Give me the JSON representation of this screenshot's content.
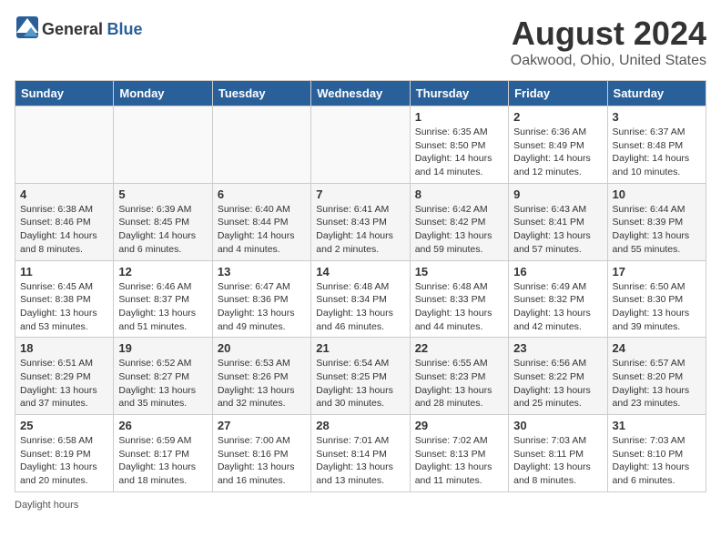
{
  "logo": {
    "general": "General",
    "blue": "Blue"
  },
  "title": {
    "month": "August 2024",
    "location": "Oakwood, Ohio, United States"
  },
  "weekdays": [
    "Sunday",
    "Monday",
    "Tuesday",
    "Wednesday",
    "Thursday",
    "Friday",
    "Saturday"
  ],
  "weeks": [
    [
      {
        "day": "",
        "info": ""
      },
      {
        "day": "",
        "info": ""
      },
      {
        "day": "",
        "info": ""
      },
      {
        "day": "",
        "info": ""
      },
      {
        "day": "1",
        "info": "Sunrise: 6:35 AM\nSunset: 8:50 PM\nDaylight: 14 hours and 14 minutes."
      },
      {
        "day": "2",
        "info": "Sunrise: 6:36 AM\nSunset: 8:49 PM\nDaylight: 14 hours and 12 minutes."
      },
      {
        "day": "3",
        "info": "Sunrise: 6:37 AM\nSunset: 8:48 PM\nDaylight: 14 hours and 10 minutes."
      }
    ],
    [
      {
        "day": "4",
        "info": "Sunrise: 6:38 AM\nSunset: 8:46 PM\nDaylight: 14 hours and 8 minutes."
      },
      {
        "day": "5",
        "info": "Sunrise: 6:39 AM\nSunset: 8:45 PM\nDaylight: 14 hours and 6 minutes."
      },
      {
        "day": "6",
        "info": "Sunrise: 6:40 AM\nSunset: 8:44 PM\nDaylight: 14 hours and 4 minutes."
      },
      {
        "day": "7",
        "info": "Sunrise: 6:41 AM\nSunset: 8:43 PM\nDaylight: 14 hours and 2 minutes."
      },
      {
        "day": "8",
        "info": "Sunrise: 6:42 AM\nSunset: 8:42 PM\nDaylight: 13 hours and 59 minutes."
      },
      {
        "day": "9",
        "info": "Sunrise: 6:43 AM\nSunset: 8:41 PM\nDaylight: 13 hours and 57 minutes."
      },
      {
        "day": "10",
        "info": "Sunrise: 6:44 AM\nSunset: 8:39 PM\nDaylight: 13 hours and 55 minutes."
      }
    ],
    [
      {
        "day": "11",
        "info": "Sunrise: 6:45 AM\nSunset: 8:38 PM\nDaylight: 13 hours and 53 minutes."
      },
      {
        "day": "12",
        "info": "Sunrise: 6:46 AM\nSunset: 8:37 PM\nDaylight: 13 hours and 51 minutes."
      },
      {
        "day": "13",
        "info": "Sunrise: 6:47 AM\nSunset: 8:36 PM\nDaylight: 13 hours and 49 minutes."
      },
      {
        "day": "14",
        "info": "Sunrise: 6:48 AM\nSunset: 8:34 PM\nDaylight: 13 hours and 46 minutes."
      },
      {
        "day": "15",
        "info": "Sunrise: 6:48 AM\nSunset: 8:33 PM\nDaylight: 13 hours and 44 minutes."
      },
      {
        "day": "16",
        "info": "Sunrise: 6:49 AM\nSunset: 8:32 PM\nDaylight: 13 hours and 42 minutes."
      },
      {
        "day": "17",
        "info": "Sunrise: 6:50 AM\nSunset: 8:30 PM\nDaylight: 13 hours and 39 minutes."
      }
    ],
    [
      {
        "day": "18",
        "info": "Sunrise: 6:51 AM\nSunset: 8:29 PM\nDaylight: 13 hours and 37 minutes."
      },
      {
        "day": "19",
        "info": "Sunrise: 6:52 AM\nSunset: 8:27 PM\nDaylight: 13 hours and 35 minutes."
      },
      {
        "day": "20",
        "info": "Sunrise: 6:53 AM\nSunset: 8:26 PM\nDaylight: 13 hours and 32 minutes."
      },
      {
        "day": "21",
        "info": "Sunrise: 6:54 AM\nSunset: 8:25 PM\nDaylight: 13 hours and 30 minutes."
      },
      {
        "day": "22",
        "info": "Sunrise: 6:55 AM\nSunset: 8:23 PM\nDaylight: 13 hours and 28 minutes."
      },
      {
        "day": "23",
        "info": "Sunrise: 6:56 AM\nSunset: 8:22 PM\nDaylight: 13 hours and 25 minutes."
      },
      {
        "day": "24",
        "info": "Sunrise: 6:57 AM\nSunset: 8:20 PM\nDaylight: 13 hours and 23 minutes."
      }
    ],
    [
      {
        "day": "25",
        "info": "Sunrise: 6:58 AM\nSunset: 8:19 PM\nDaylight: 13 hours and 20 minutes."
      },
      {
        "day": "26",
        "info": "Sunrise: 6:59 AM\nSunset: 8:17 PM\nDaylight: 13 hours and 18 minutes."
      },
      {
        "day": "27",
        "info": "Sunrise: 7:00 AM\nSunset: 8:16 PM\nDaylight: 13 hours and 16 minutes."
      },
      {
        "day": "28",
        "info": "Sunrise: 7:01 AM\nSunset: 8:14 PM\nDaylight: 13 hours and 13 minutes."
      },
      {
        "day": "29",
        "info": "Sunrise: 7:02 AM\nSunset: 8:13 PM\nDaylight: 13 hours and 11 minutes."
      },
      {
        "day": "30",
        "info": "Sunrise: 7:03 AM\nSunset: 8:11 PM\nDaylight: 13 hours and 8 minutes."
      },
      {
        "day": "31",
        "info": "Sunrise: 7:03 AM\nSunset: 8:10 PM\nDaylight: 13 hours and 6 minutes."
      }
    ]
  ],
  "footer": "Daylight hours"
}
